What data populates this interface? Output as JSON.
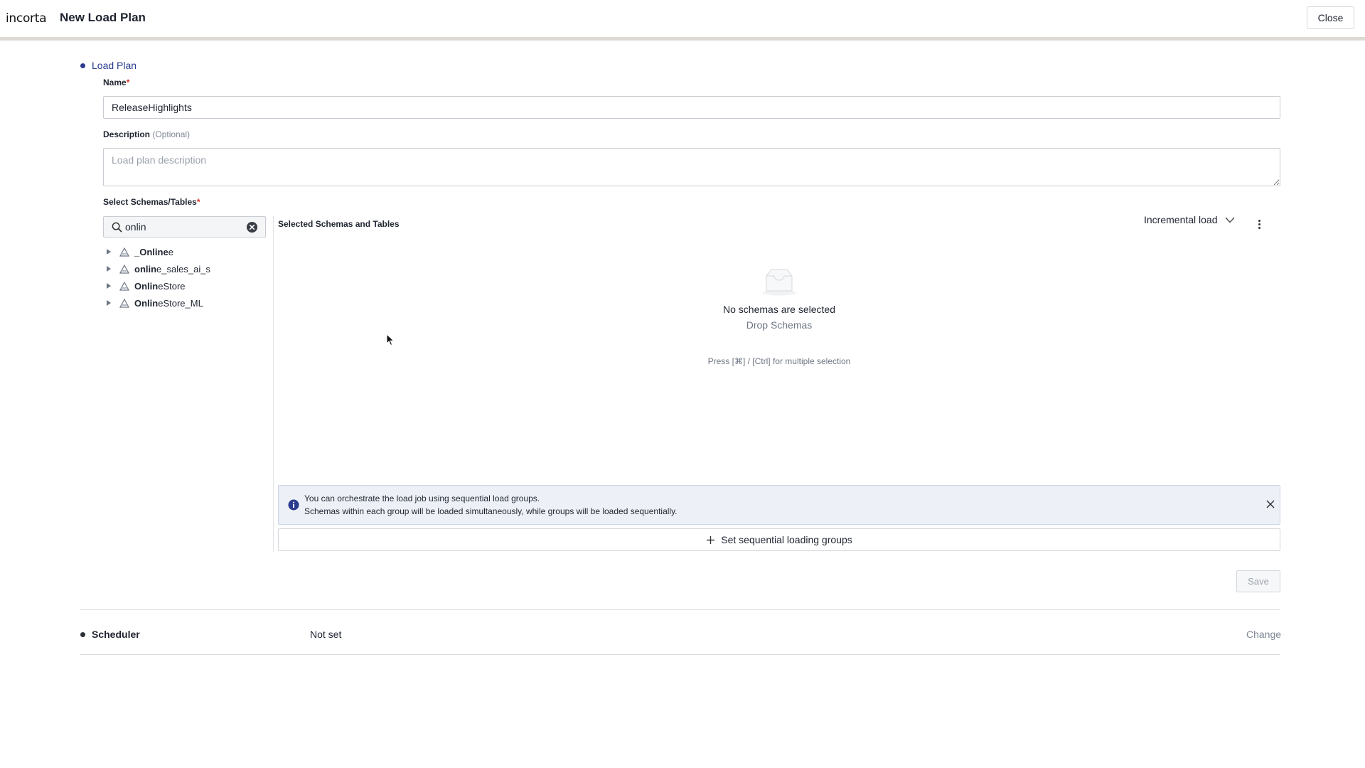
{
  "header": {
    "logo": "incorta",
    "title": "New Load Plan",
    "close_label": "Close"
  },
  "load_plan": {
    "section_title": "Load Plan",
    "name_label": "Name",
    "name_required": "*",
    "name_value": "ReleaseHighlights",
    "description_label": "Description",
    "description_optional": "(Optional)",
    "description_placeholder": "Load plan description",
    "select_label": "Select Schemas/Tables",
    "select_required": "*",
    "search_value": "onlin",
    "schemas": [
      {
        "match": "_Online",
        "rest": "e"
      },
      {
        "match": "onlin",
        "rest": "e_sales_ai_s"
      },
      {
        "match": "Onlin",
        "rest": "eStore"
      },
      {
        "match": "Onlin",
        "rest": "eStore_ML"
      }
    ],
    "selected_panel_title": "Selected Schemas and Tables",
    "load_type": "Incremental load",
    "empty_title": "No schemas are selected",
    "empty_subtitle": "Drop Schemas",
    "empty_hint": "Press [⌘] / [Ctrl] for multiple selection",
    "info_line1": "You can orchestrate the load job using sequential load groups.",
    "info_line2": "Schemas within each group will be loaded simultaneously, while groups will be loaded sequentially.",
    "seq_button_label": "Set sequential loading groups",
    "save_label": "Save"
  },
  "scheduler": {
    "section_title": "Scheduler",
    "value": "Not set",
    "change_label": "Change"
  },
  "colors": {
    "accent": "#2a3b8f",
    "required": "#d93025",
    "info_bg": "#edf1f7"
  }
}
